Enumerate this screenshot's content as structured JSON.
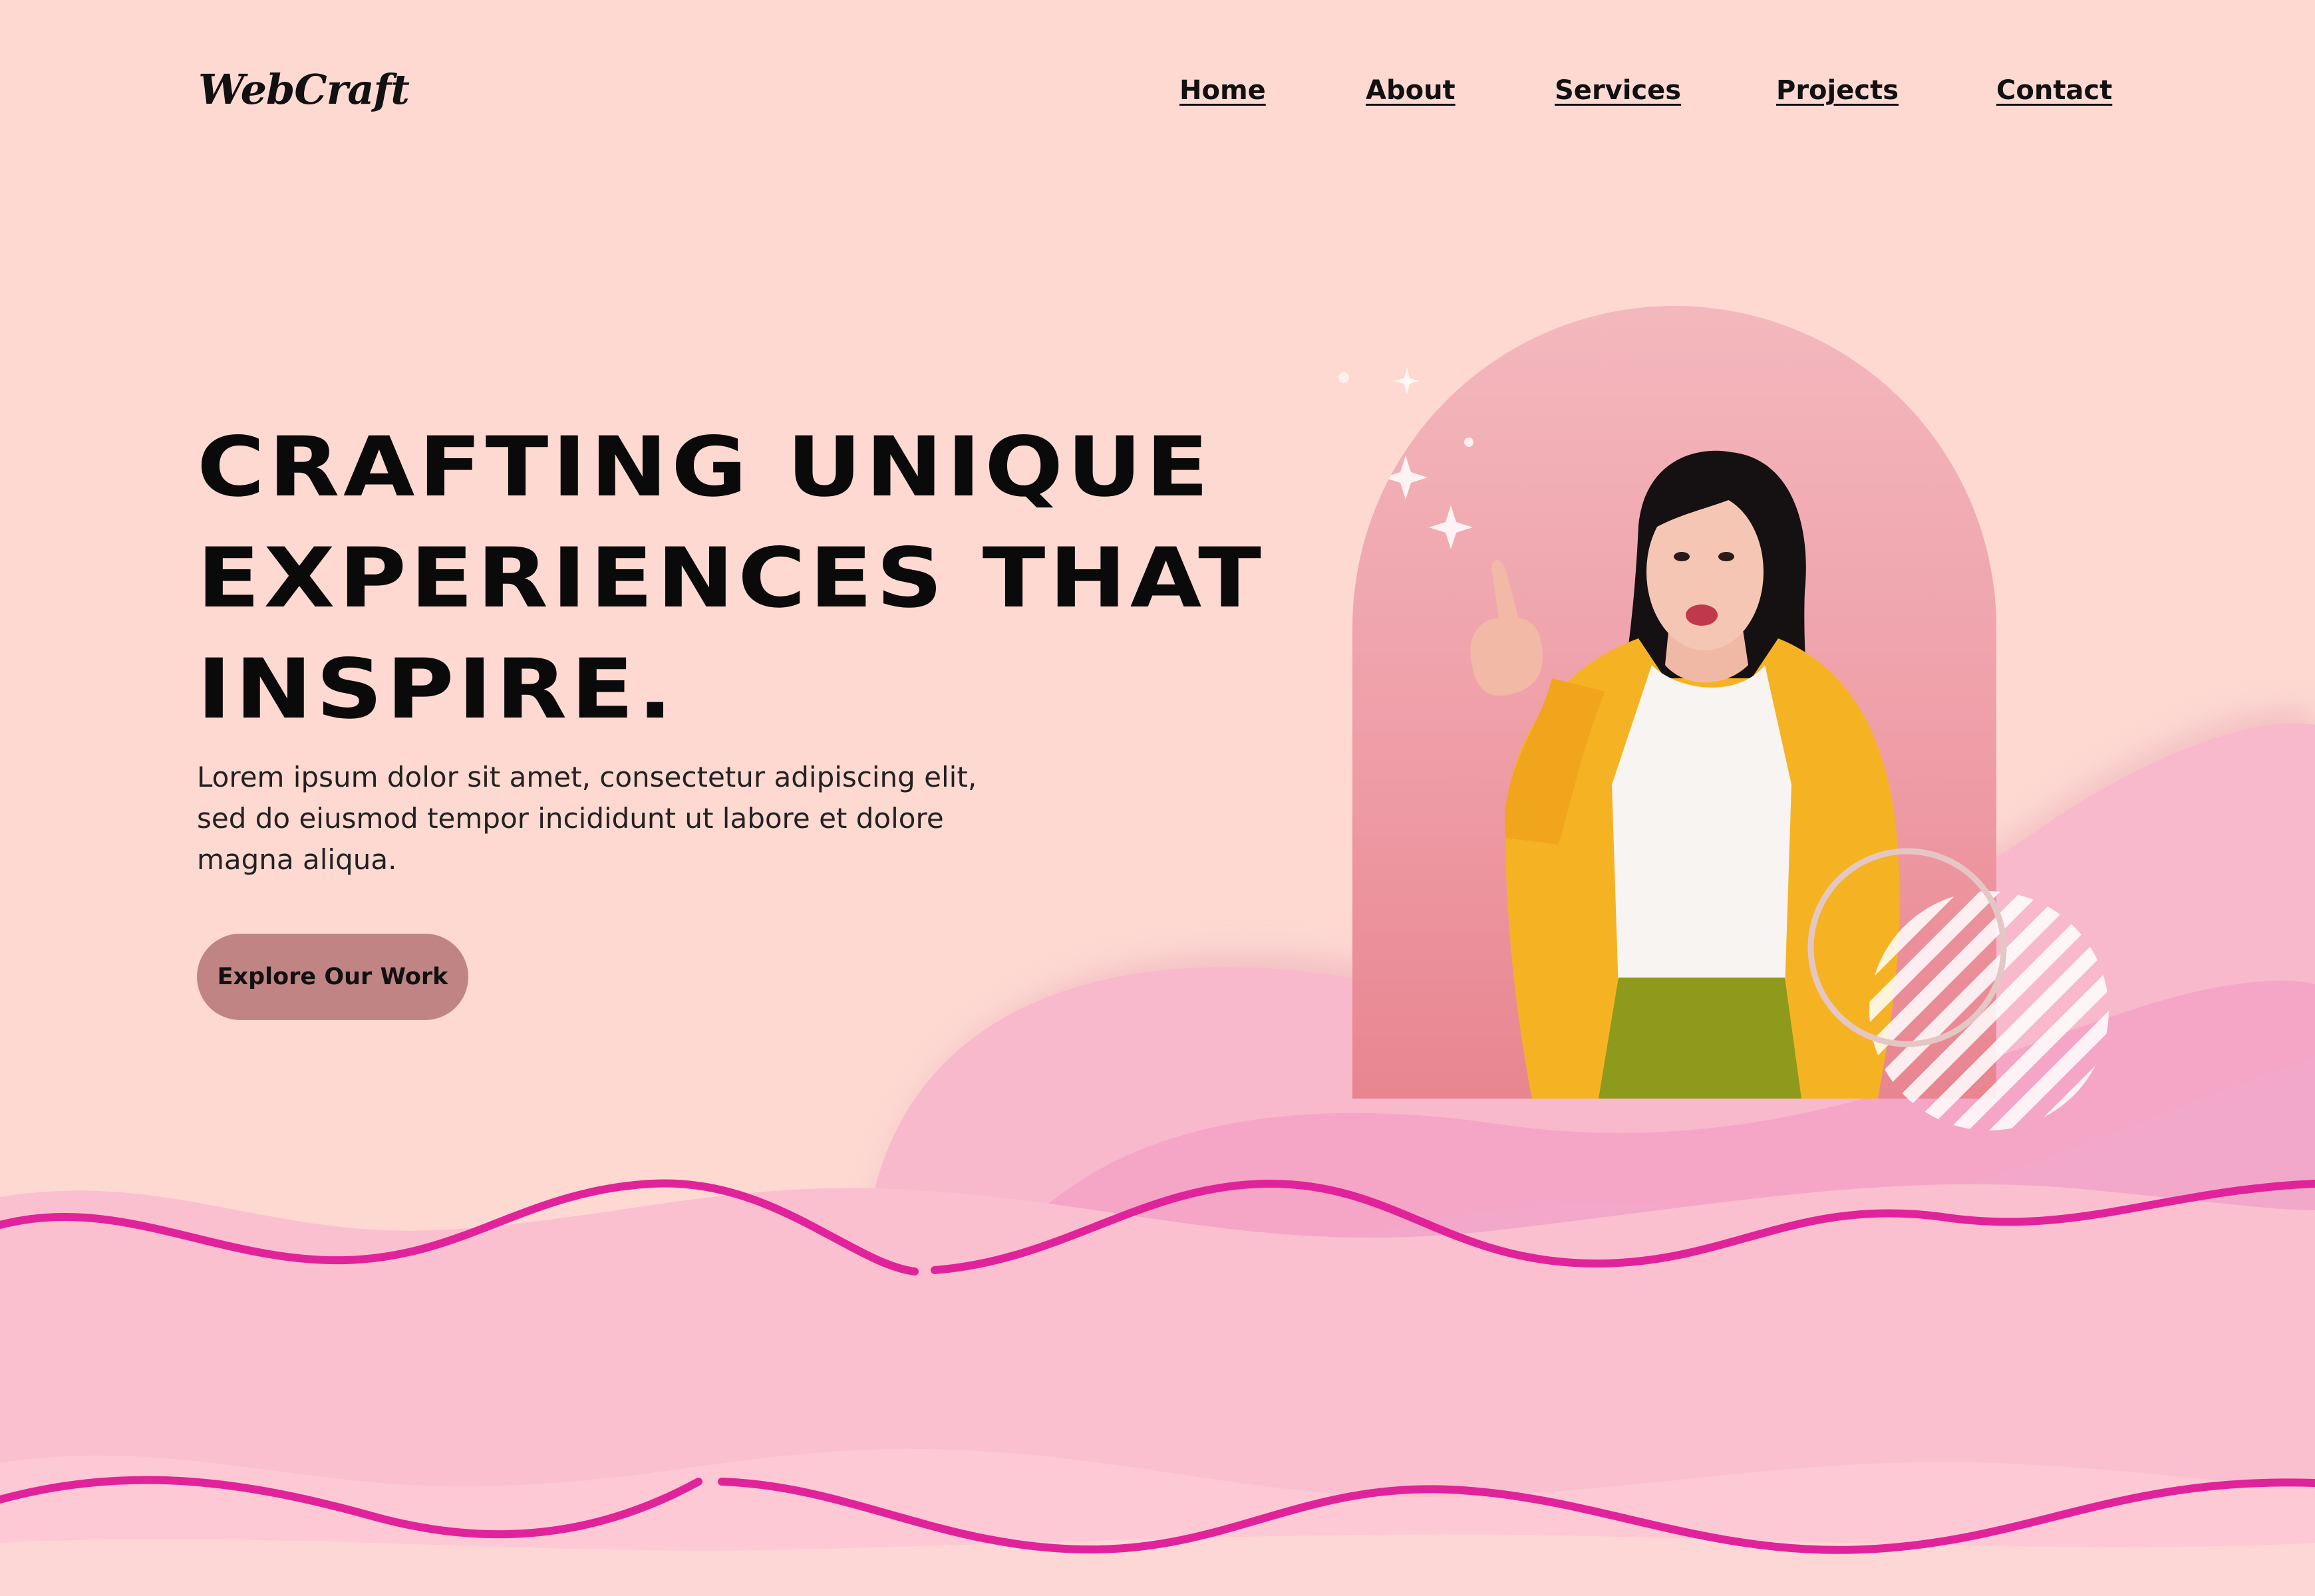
{
  "brand": {
    "logo": "WebCraft"
  },
  "nav": {
    "items": [
      "Home",
      "About",
      "Services",
      "Projects",
      "Contact"
    ]
  },
  "hero": {
    "headline_lines": [
      "CRAFTING UNIQUE",
      "EXPERIENCES THAT",
      "INSPIRE."
    ],
    "lead_lines": [
      "Lorem ipsum dolor sit amet, consectetur adipiscing elit,",
      "sed do eiusmod tempor incididunt ut labore et dolore",
      "magna aliqua."
    ],
    "cta_label": "Explore Our Work"
  },
  "colors": {
    "background": "#fdd9d2",
    "cta": "#c08484",
    "wave_line": "#e0239a",
    "wave_fill": "#fbbfcf",
    "cardigan": "#f5b324"
  },
  "icons": [
    "sparkle-icon",
    "striped-circle-decoration",
    "ring-decoration"
  ]
}
